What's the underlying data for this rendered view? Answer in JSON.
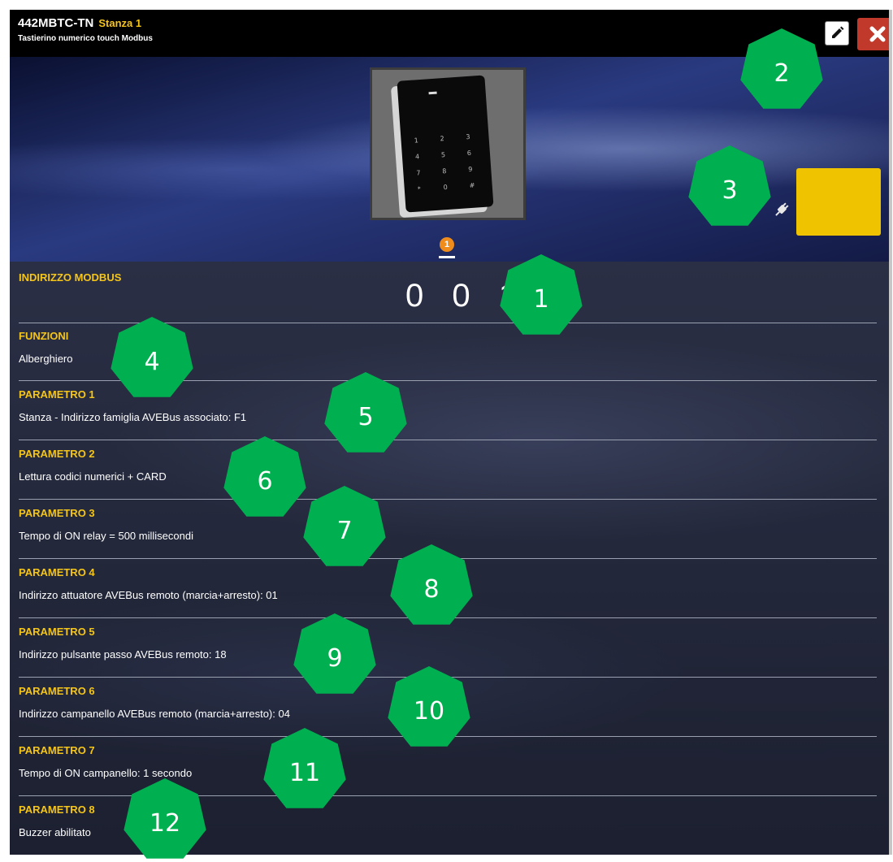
{
  "window": {
    "device_code": "442MBTC-TN",
    "room": "Stanza 1",
    "subtitle": "Tastierino numerico touch Modbus"
  },
  "header": {
    "page_indicator": "1",
    "keypad_keys": [
      "1",
      "2",
      "3",
      "4",
      "5",
      "6",
      "7",
      "8",
      "9",
      "*",
      "0",
      "#"
    ],
    "status_color": "#f0c300"
  },
  "modbus": {
    "label": "INDIRIZZO MODBUS",
    "digits": "0 0 1"
  },
  "functions": {
    "label": "FUNZIONI",
    "value": "Alberghiero"
  },
  "params": [
    {
      "label": "PARAMETRO 1",
      "value": "Stanza - Indirizzo famiglia AVEBus associato: F1"
    },
    {
      "label": "PARAMETRO 2",
      "value": "Lettura codici numerici + CARD"
    },
    {
      "label": "PARAMETRO 3",
      "value": "Tempo di ON relay = 500 millisecondi"
    },
    {
      "label": "PARAMETRO 4",
      "value": "Indirizzo attuatore AVEBus remoto (marcia+arresto): 01"
    },
    {
      "label": "PARAMETRO 5",
      "value": "Indirizzo pulsante passo AVEBus remoto: 18"
    },
    {
      "label": "PARAMETRO 6",
      "value": "Indirizzo campanello AVEBus remoto (marcia+arresto): 04"
    },
    {
      "label": "PARAMETRO 7",
      "value": "Tempo di ON campanello: 1 secondo"
    },
    {
      "label": "PARAMETRO 8",
      "value": "Buzzer abilitato"
    }
  ],
  "callouts": [
    "1",
    "2",
    "3",
    "4",
    "5",
    "6",
    "7",
    "8",
    "9",
    "10",
    "11",
    "12"
  ],
  "icons": {
    "edit": "pencil-icon",
    "close": "close-icon",
    "plug": "plug-icon"
  },
  "colors": {
    "accent_yellow": "#f5c518",
    "close_red": "#c0392b",
    "callout_green": "#00b050"
  }
}
